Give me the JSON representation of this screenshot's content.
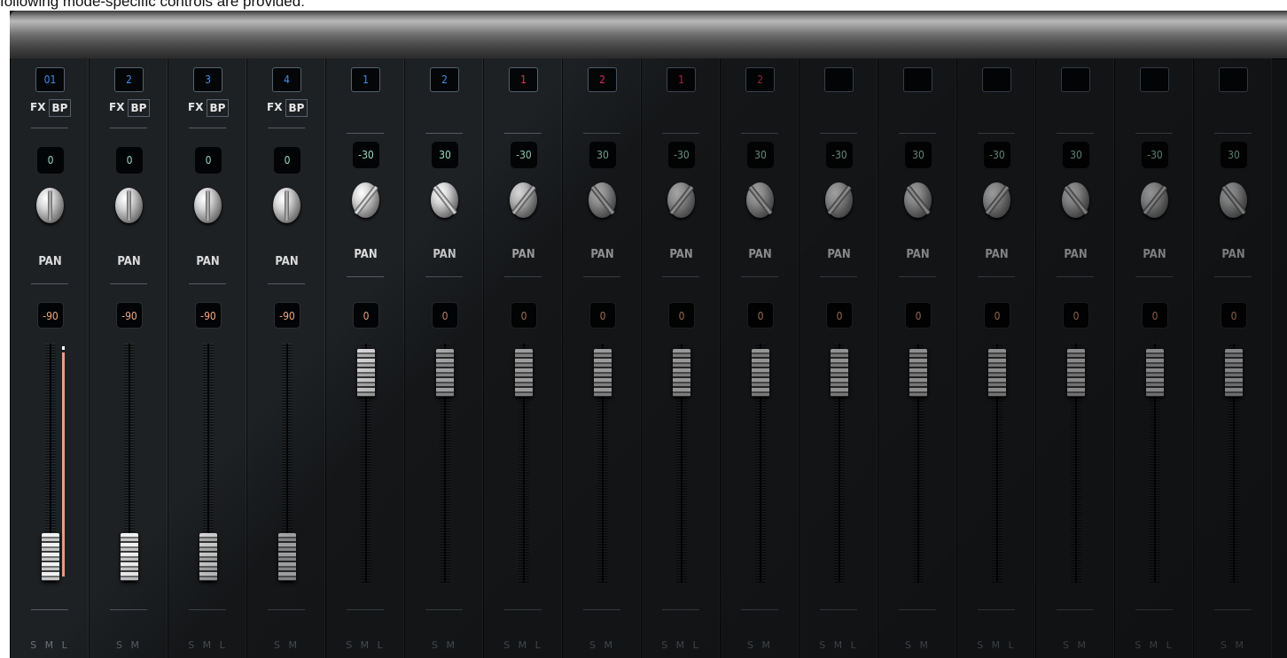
{
  "intro_text": "following mode-specific controls are provided:",
  "colors": {
    "blue": "#3f8fe6",
    "red": "#e0375a",
    "teal": "#9ad7c2",
    "salmon": "#efa784"
  },
  "strips": [
    {
      "channel": "01",
      "channel_color": "blue",
      "has_fxbp": true,
      "fx_label": "FX",
      "bp_label": "BP",
      "value": "0",
      "value_color": "teal",
      "knob": "plain",
      "pan_label": "PAN",
      "level": "-90",
      "level_color": "salmon",
      "fader_state": "down",
      "meter": true,
      "sml": "S M L"
    },
    {
      "channel": "2",
      "channel_color": "blue",
      "has_fxbp": true,
      "fx_label": "FX",
      "bp_label": "BP",
      "value": "0",
      "value_color": "teal",
      "knob": "plain",
      "pan_label": "PAN",
      "level": "-90",
      "level_color": "salmon",
      "fader_state": "down",
      "meter": false,
      "sml": "S M"
    },
    {
      "channel": "3",
      "channel_color": "blue",
      "has_fxbp": true,
      "fx_label": "FX",
      "bp_label": "BP",
      "value": "0",
      "value_color": "teal",
      "knob": "plain",
      "pan_label": "PAN",
      "level": "-90",
      "level_color": "salmon",
      "fader_state": "down",
      "meter": false,
      "sml": "S M L"
    },
    {
      "channel": "4",
      "channel_color": "blue",
      "has_fxbp": true,
      "fx_label": "FX",
      "bp_label": "BP",
      "value": "0",
      "value_color": "teal",
      "knob": "plain",
      "pan_label": "PAN",
      "level": "-90",
      "level_color": "salmon",
      "fader_state": "down",
      "meter": false,
      "sml": "S M"
    },
    {
      "channel": "1",
      "channel_color": "blue",
      "has_fxbp": false,
      "value": "-30",
      "value_color": "teal",
      "knob": "slash",
      "pan_label": "PAN",
      "level": "0",
      "level_color": "salmon",
      "fader_state": "up",
      "meter": false,
      "sml": "S M L"
    },
    {
      "channel": "2",
      "channel_color": "blue",
      "has_fxbp": false,
      "value": "30",
      "value_color": "teal",
      "knob": "bslash",
      "pan_label": "PAN",
      "level": "0",
      "level_color": "salmon",
      "fader_state": "up",
      "meter": false,
      "sml": "S M"
    },
    {
      "channel": "1",
      "channel_color": "red",
      "has_fxbp": false,
      "value": "-30",
      "value_color": "teal",
      "knob": "slash",
      "pan_label": "PAN",
      "level": "0",
      "level_color": "salmon",
      "fader_state": "up",
      "meter": false,
      "sml": "S M L"
    },
    {
      "channel": "2",
      "channel_color": "red",
      "has_fxbp": false,
      "value": "30",
      "value_color": "teal",
      "knob": "bslash",
      "pan_label": "PAN",
      "level": "0",
      "level_color": "salmon",
      "fader_state": "up",
      "meter": false,
      "sml": "S M"
    },
    {
      "channel": "1",
      "channel_color": "red",
      "has_fxbp": false,
      "value": "-30",
      "value_color": "teal",
      "knob": "slash",
      "pan_label": "PAN",
      "level": "0",
      "level_color": "salmon",
      "fader_state": "up",
      "meter": false,
      "sml": "S M L"
    },
    {
      "channel": "2",
      "channel_color": "red",
      "has_fxbp": false,
      "value": "30",
      "value_color": "teal",
      "knob": "bslash",
      "pan_label": "PAN",
      "level": "0",
      "level_color": "salmon",
      "fader_state": "up",
      "meter": false,
      "sml": "S M"
    },
    {
      "channel": "",
      "channel_color": "blue",
      "has_fxbp": false,
      "value": "-30",
      "value_color": "teal",
      "knob": "slash",
      "pan_label": "PAN",
      "level": "0",
      "level_color": "salmon",
      "fader_state": "up",
      "meter": false,
      "sml": "S M L"
    },
    {
      "channel": "",
      "channel_color": "blue",
      "has_fxbp": false,
      "value": "30",
      "value_color": "teal",
      "knob": "bslash",
      "pan_label": "PAN",
      "level": "0",
      "level_color": "salmon",
      "fader_state": "up",
      "meter": false,
      "sml": "S M"
    },
    {
      "channel": "",
      "channel_color": "blue",
      "has_fxbp": false,
      "value": "-30",
      "value_color": "teal",
      "knob": "slash",
      "pan_label": "PAN",
      "level": "0",
      "level_color": "salmon",
      "fader_state": "up",
      "meter": false,
      "sml": "S M L"
    },
    {
      "channel": "",
      "channel_color": "blue",
      "has_fxbp": false,
      "value": "30",
      "value_color": "teal",
      "knob": "bslash",
      "pan_label": "PAN",
      "level": "0",
      "level_color": "salmon",
      "fader_state": "up",
      "meter": false,
      "sml": "S M"
    },
    {
      "channel": "",
      "channel_color": "blue",
      "has_fxbp": false,
      "value": "-30",
      "value_color": "teal",
      "knob": "slash",
      "pan_label": "PAN",
      "level": "0",
      "level_color": "salmon",
      "fader_state": "up",
      "meter": false,
      "sml": "S M L"
    },
    {
      "channel": "",
      "channel_color": "blue",
      "has_fxbp": false,
      "value": "30",
      "value_color": "teal",
      "knob": "bslash",
      "pan_label": "PAN",
      "level": "0",
      "level_color": "salmon",
      "fader_state": "up",
      "meter": false,
      "sml": "S M"
    }
  ]
}
